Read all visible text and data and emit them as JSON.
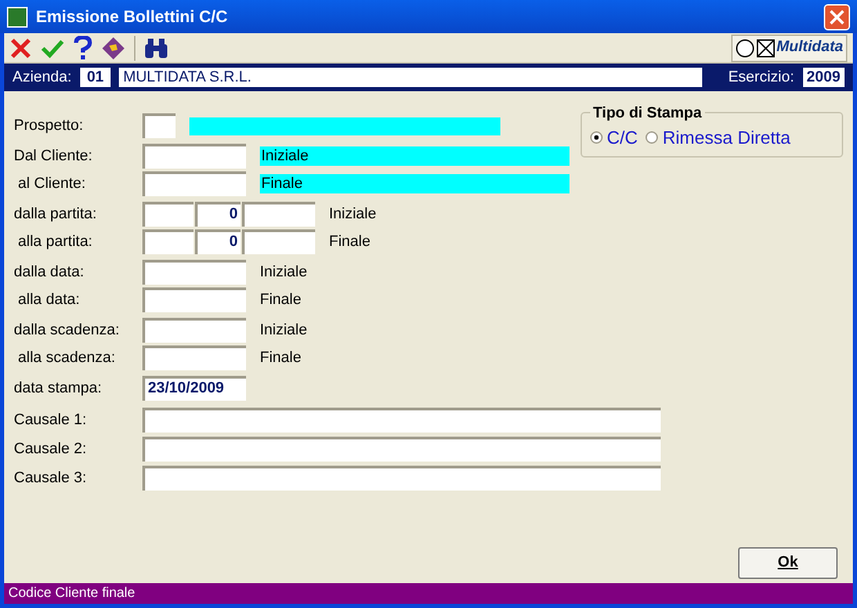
{
  "window": {
    "title": "Emissione Bollettini C/C"
  },
  "header": {
    "company_label": "Azienda:",
    "company_code": "01",
    "company_name": "MULTIDATA S.R.L.",
    "year_label": "Esercizio:",
    "year": "2009"
  },
  "logo": {
    "text": "Multidata"
  },
  "form": {
    "groups": [
      [
        {
          "kind": "code",
          "label": "Prospetto:"
        }
      ],
      [
        {
          "kind": "lookup",
          "label": "Dal Cliente:",
          "desc": "Iniziale"
        },
        {
          "kind": "lookup",
          "label": " al Cliente:",
          "desc": "Finale"
        }
      ],
      [
        {
          "kind": "split",
          "label": "dalla partita:",
          "middle": "0",
          "hint": "Iniziale"
        },
        {
          "kind": "split",
          "label": " alla partita:",
          "middle": "0",
          "hint": "Finale"
        }
      ],
      [
        {
          "kind": "field",
          "label": "dalla data:",
          "hint": "Iniziale"
        },
        {
          "kind": "field",
          "label": " alla data:",
          "hint": "Finale"
        }
      ],
      [
        {
          "kind": "field",
          "label": "dalla scadenza:",
          "hint": "Iniziale"
        },
        {
          "kind": "field",
          "label": " alla scadenza:",
          "hint": "Finale"
        }
      ],
      [
        {
          "kind": "field",
          "label": "data stampa:",
          "value": "23/10/2009"
        }
      ]
    ],
    "causali": [
      "Causale 1:",
      "Causale 2:",
      "Causale 3:"
    ]
  },
  "print_type": {
    "title": "Tipo di Stampa",
    "options": [
      {
        "label": "C/C",
        "selected": true
      },
      {
        "label": "Rimessa Diretta",
        "selected": false
      }
    ]
  },
  "ok_button": "Ok",
  "status_bar": "Codice Cliente finale"
}
